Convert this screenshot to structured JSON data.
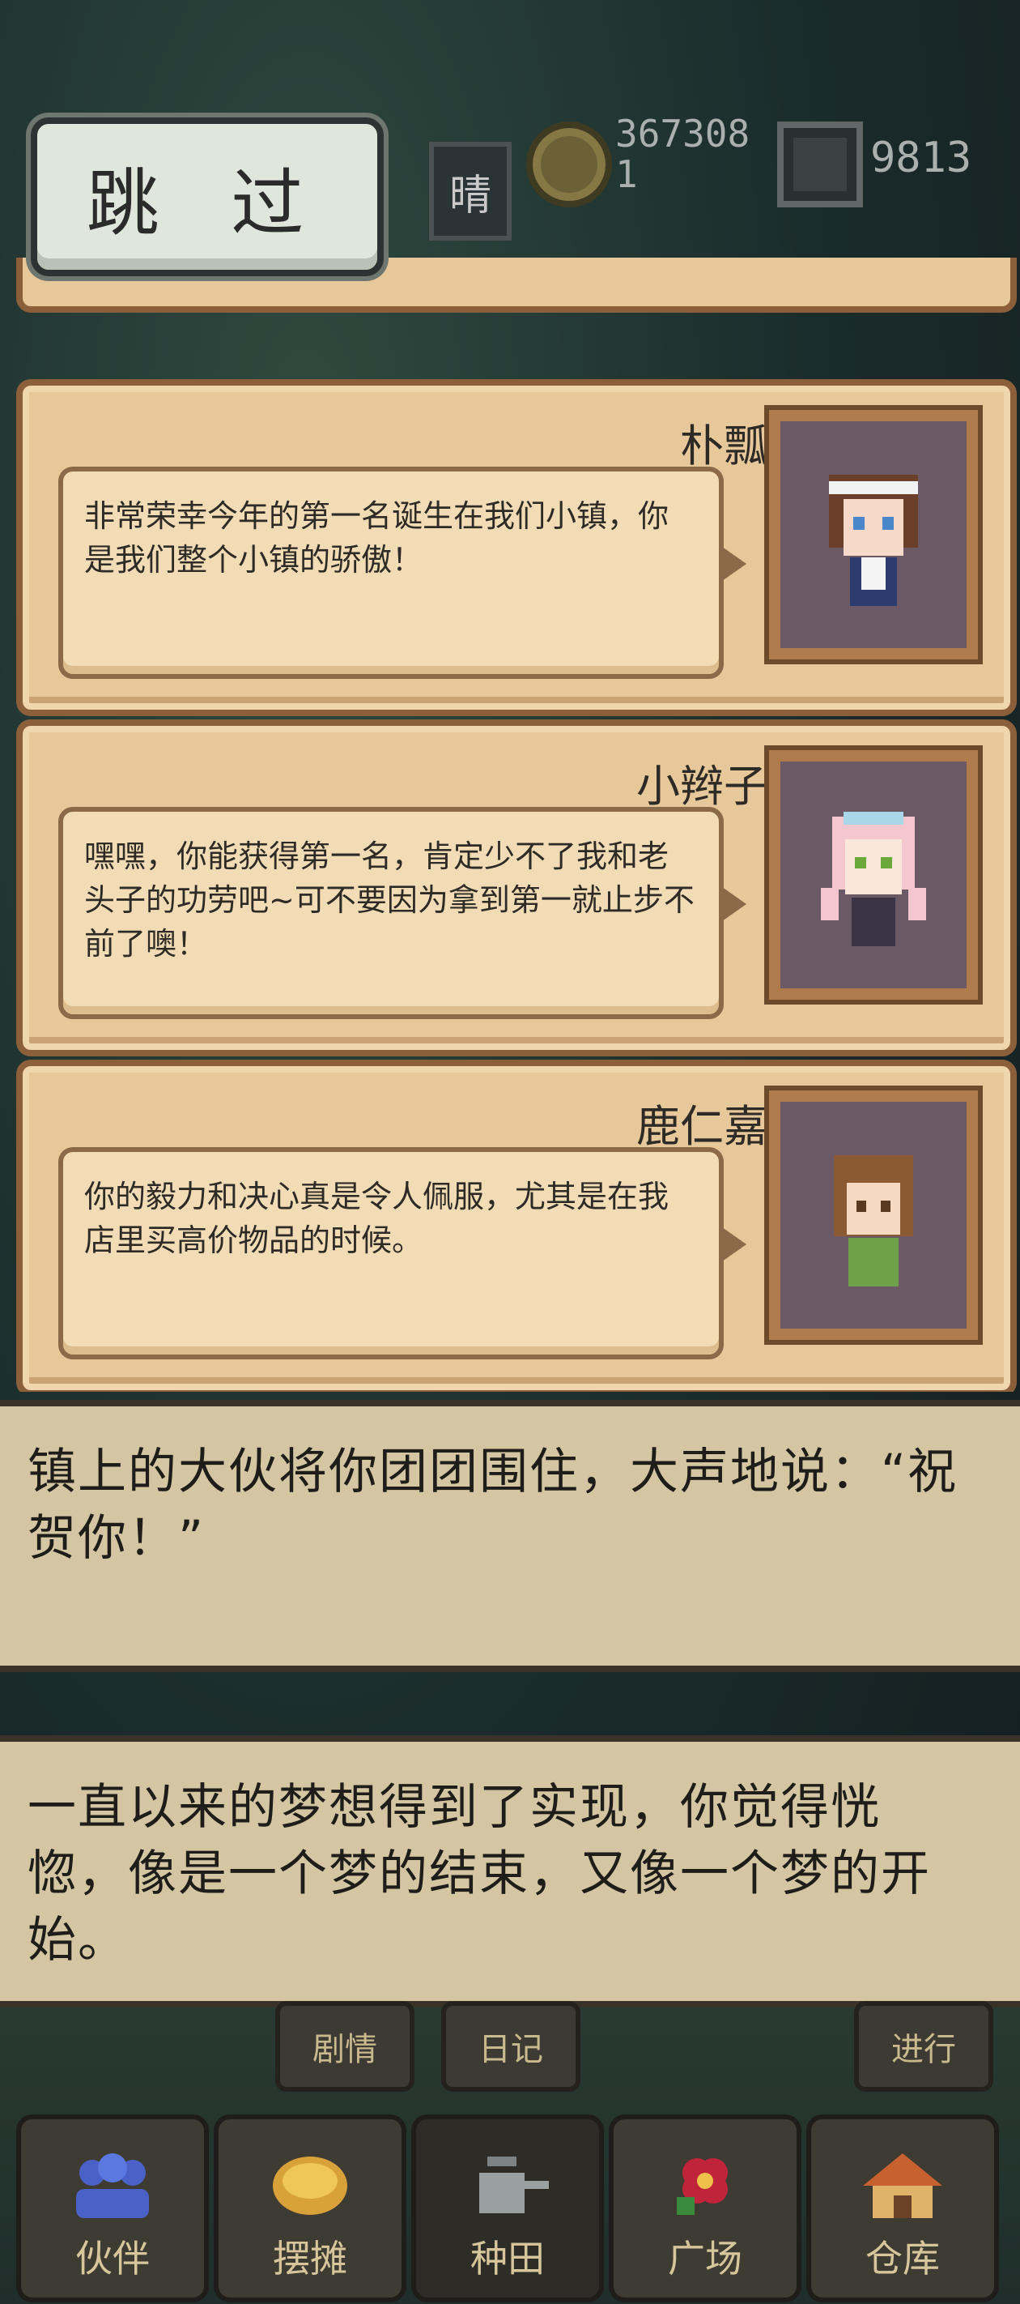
{
  "hud": {
    "weather": "晴",
    "coins": "3673081",
    "gems": "9813"
  },
  "skip_label": "跳 过",
  "dialogues": [
    {
      "name": "朴瓢",
      "text": "非常荣幸今年的第一名诞生在我们小镇，你是我们整个小镇的骄傲！"
    },
    {
      "name": "小辫子",
      "text": "嘿嘿，你能获得第一名，肯定少不了我和老头子的功劳吧~可不要因为拿到第一就止步不前了噢！"
    },
    {
      "name": "鹿仁嘉",
      "text": "你的毅力和决心真是令人佩服，尤其是在我店里买高价物品的时候。"
    }
  ],
  "narration": [
    "镇上的大伙将你团团围住，大声地说：“祝贺你！”",
    "一直以来的梦想得到了实现，你觉得恍惚，像是一个梦的结束，又像一个梦的开始。"
  ],
  "actions": {
    "story": "剧情",
    "diary": "日记",
    "proceed": "进行"
  },
  "nav": [
    {
      "label": "伙伴",
      "icon": "people-icon"
    },
    {
      "label": "摆摊",
      "icon": "stall-icon"
    },
    {
      "label": "种田",
      "icon": "watering-can-icon"
    },
    {
      "label": "广场",
      "icon": "flower-icon"
    },
    {
      "label": "仓库",
      "icon": "house-icon"
    }
  ],
  "colors": {
    "panel": "#e7c89a",
    "panel_border": "#8a5f3a",
    "narration_bg": "#d4c6a2"
  }
}
